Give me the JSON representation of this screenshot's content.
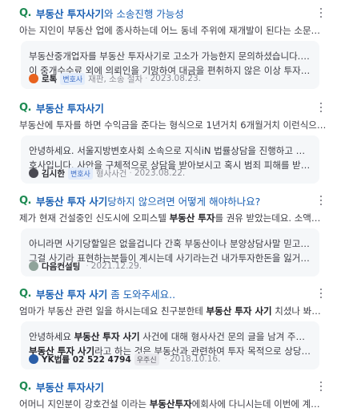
{
  "colors": {
    "q_icon": "#1d8a52",
    "title_link": "#1a60b3",
    "card_background": "#f5f7f9",
    "expert_badge_bg": "#e3ecfa"
  },
  "results": [
    {
      "q_icon": "Q.",
      "title_hl": "부동산 투자사기",
      "title_rest": "와 소송진행 가능성",
      "question": "아는 지인이 부동산 업에 종사하는데 어느 동네 주위에 재개발이 된다는 소문을 들었는...",
      "answer_lines": [
        [
          "부동산중개업자를 부동산 투자사기로 고소가 가능한지 문의하셨습니다. 부동산중개인"
        ],
        [
          "이 중개수수료 외에 의뢰인을 기망하여 대금을 편취하지 않은 이상 투자사기를 입증..."
        ]
      ],
      "author": "로톡",
      "author_icon": "lawtalk-logo-icon",
      "author_color": "#e8621e",
      "badge": "변호사",
      "category": "재판, 소송 절차",
      "date": "2023.08.23."
    },
    {
      "q_icon": "Q.",
      "title_hl": "부동산 투자사기",
      "title_rest": "",
      "question": "부동산에 투자를 하면 수익금을 준다는 형식으로 1년거치 6개월거치 이런식으로 해서 만...",
      "answer_lines": [
        [
          "안녕하세요. 서울지방변호사회 소속으로 지식iN 법률상담을 진행하고 있는 김시한 변"
        ],
        [
          "호사입니다. 사안을 구체적으로 상담을 받아보시고 혹시 범죄 피해를 받은 것은 아..."
        ]
      ],
      "author": "김시한",
      "author_icon": "profile-photo-icon",
      "author_color": "#4a4a52",
      "badge": "변호사",
      "category": "형사사건",
      "date": "2023.08.22."
    },
    {
      "q_icon": "Q.",
      "title_hl": "부동산 투자 사기",
      "title_rest": "당하지 않으려면 어떻게 해야하나요?",
      "question_parts": [
        "제가 현재 건설중인 신도시에 오피스텔 ",
        "부동산 투자",
        "를 권유 받았는데요. 소액투자인데 부..."
      ],
      "answer_lines": [
        [
          "아니라면 사기당할일은 없을겁니다 간혹 부동산이나 분양상담사말 믿고 투자했는데"
        ],
        [
          "그걸 사기라 표현하는분들이 계시는데 사기라는건 내가투자한돈을 잃거나 또는 허..."
        ]
      ],
      "author": "다음컨설팅",
      "author_icon": "consulting-logo-icon",
      "author_color": "#8fa39a",
      "badge": "",
      "category": "",
      "date": "2021.12.29."
    },
    {
      "q_icon": "Q.",
      "title_hl": "부동산 투자 사기",
      "title_rest": " 좀 도와주세요..",
      "question_parts": [
        "엄마가 부동산 관련 일을 하시는데요 친구분한테 ",
        "부동산 투자 사기",
        " 치셨나 봐요 분명히 ..."
      ],
      "answer_lines": [
        [
          "안녕하세요 부동산 투자 사기 사건에 대해 형사사건 문의 글을 남겨 주셨습니다. 먼저,"
        ],
        [
          "부동산 투자 사기라고 하는 것은 부동산과 관련하여 투자 목적으로 상당히 높은 이..."
        ]
      ],
      "author": "YK법률 02 522 4794",
      "author_icon": "yk-logo-icon",
      "author_color": "#2a5ea8",
      "badge": "우주신",
      "badge_grey": true,
      "category": "",
      "date": "2018.10.16."
    },
    {
      "q_icon": "Q.",
      "title_hl": "부동산 투자사기",
      "title_rest": "",
      "question_parts": [
        "어머니 지인분이 강호건설 이라는 ",
        "부동산투자",
        "에회사에 다니시는데 이번에 계약을 못하..."
      ]
    }
  ]
}
